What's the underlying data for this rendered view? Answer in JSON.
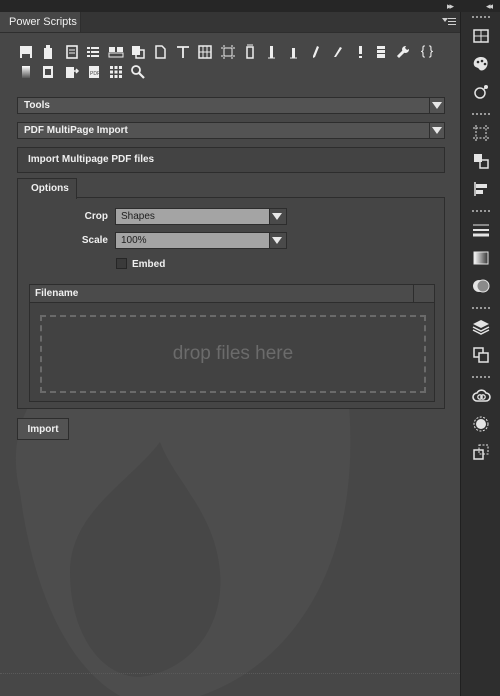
{
  "panel": {
    "title": "Power Scripts"
  },
  "toolbar": {
    "row1": [
      "chair-icon",
      "bottle-icon",
      "document-icon",
      "list-icon",
      "card-icon",
      "copy-icon",
      "page-icon",
      "text-tool-icon",
      "grid-icon",
      "crop-marks-icon",
      "column-icon",
      "bar-1-icon",
      "bar-2-icon",
      "pen-icon",
      "pencil-icon",
      "exclaim-icon",
      "stack-icon",
      "wrench-icon",
      "braces-icon"
    ],
    "row2": [
      "gradient-icon",
      "sheet-icon",
      "export-icon",
      "pdf-icon",
      "tiles-icon",
      "magnifier-icon"
    ],
    "braces": "{ }"
  },
  "tools_select": {
    "value": "Tools"
  },
  "script_select": {
    "value": "PDF MultiPage Import"
  },
  "description": {
    "text": "Import Multipage PDF files"
  },
  "options_tab": {
    "label": "Options"
  },
  "form": {
    "crop_label": "Crop",
    "crop_value": "Shapes",
    "scale_label": "Scale",
    "scale_value": "100%",
    "embed_label": "Embed",
    "embed_checked": false
  },
  "filelist": {
    "column": "Filename",
    "drop_text": "drop files here"
  },
  "import_button": {
    "label": "Import"
  },
  "sidebar": {
    "groups": [
      [
        "grid-icon",
        "palette-icon",
        "graph-icon"
      ],
      [
        "artboard-icon",
        "arrange-icon",
        "align-icon"
      ],
      [
        "stroke-icon",
        "gradient-icon",
        "transparency-icon"
      ],
      [
        "layers-icon",
        "artboards-icon"
      ],
      [
        "creative-cloud-icon",
        "appearance-icon",
        "transform-icon"
      ]
    ]
  }
}
